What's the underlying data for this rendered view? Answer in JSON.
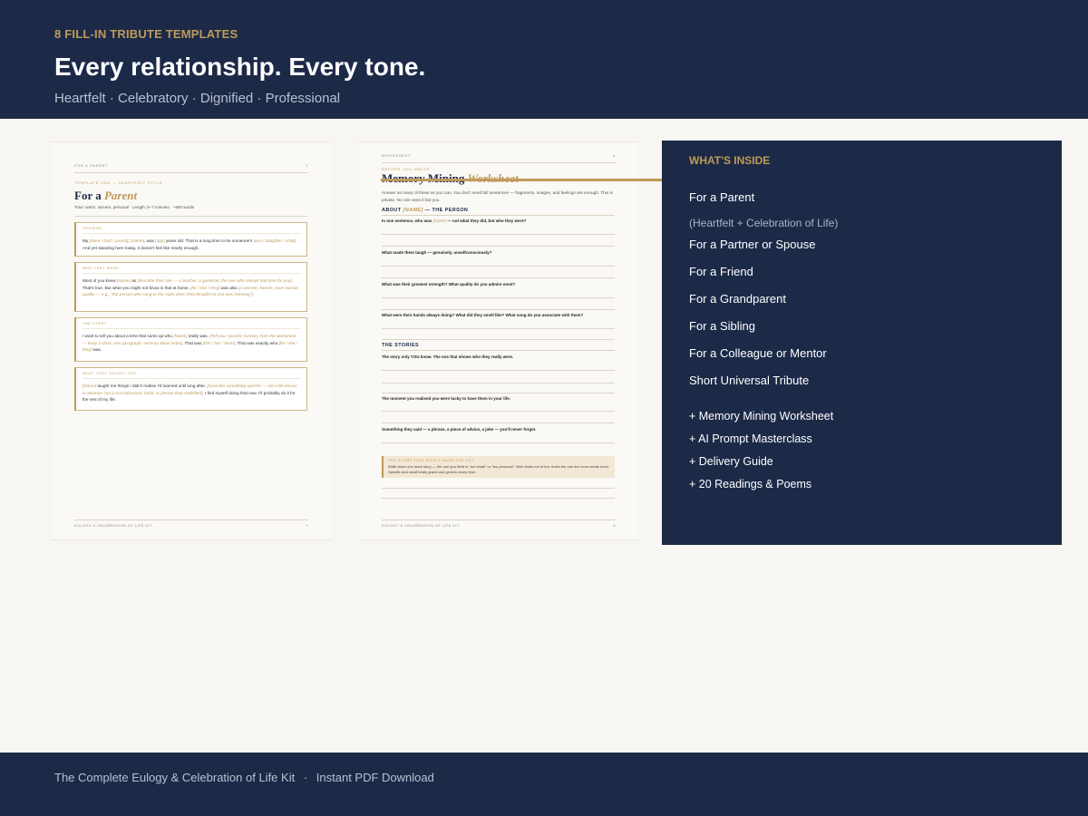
{
  "header": {
    "eyebrow": "8 FILL-IN TRIBUTE TEMPLATES",
    "headline": "Every relationship. Every tone.",
    "subline": "Heartfelt · Celebratory · Dignified · Professional"
  },
  "page1": {
    "running_header": "FOR A PARENT",
    "page_number": "7",
    "kicker": "TEMPLATE ONE — HEARTFELT STYLE",
    "title_prefix": "For a ",
    "title_accent": "Parent",
    "meta": "Tone: warm, sincere, personal · Length: 5–7 minutes · ~900 words",
    "sections": [
      {
        "label": "OPENING",
        "parts": [
          [
            "My ",
            ""
          ],
          [
            "[Mum / Dad / parent]",
            "fill"
          ],
          [
            ", ",
            ""
          ],
          [
            "[Name]",
            "fill"
          ],
          [
            ", was ",
            ""
          ],
          [
            "[age]",
            "fill"
          ],
          [
            " years old. That is a long time to be someone's ",
            ""
          ],
          [
            "[son / daughter / child]",
            "fill"
          ],
          [
            ". And yet standing here today, it doesn't feel like nearly enough.",
            ""
          ]
        ]
      },
      {
        "label": "WHO THEY WERE",
        "parts": [
          [
            "Most of you knew ",
            ""
          ],
          [
            "[Name]",
            "fill"
          ],
          [
            " as ",
            ""
          ],
          [
            "[describe their role — a teacher, a gardener, the one who always had time for you]",
            "fill"
          ],
          [
            ". That's true. But what you might not know is that at home, ",
            ""
          ],
          [
            "[he / she / they]",
            "fill"
          ],
          [
            " was also ",
            ""
          ],
          [
            "[a warmer, funnier, more human quality — e.g., \"the person who sang to the radio when they thought no one was listening\"]",
            "fill"
          ],
          [
            ".",
            ""
          ]
        ]
      },
      {
        "label": "THE STORY",
        "parts": [
          [
            "I want to tell you about a time that sums up who ",
            ""
          ],
          [
            "[Name]",
            "fill"
          ],
          [
            " really was. ",
            ""
          ],
          [
            "[Tell your specific memory from the worksheet — keep it short, one paragraph, sensory detail helps]",
            "fill"
          ],
          [
            ". That was ",
            ""
          ],
          [
            "[him / her / them]",
            "fill"
          ],
          [
            ". That was exactly who ",
            ""
          ],
          [
            "[he / she / they]",
            "fill"
          ],
          [
            " was.",
            ""
          ]
        ]
      },
      {
        "label": "WHAT THEY TAUGHT YOU",
        "parts": [
          [
            "[Name]",
            "fill"
          ],
          [
            " taught me things I didn't realise I'd learned until long after. ",
            ""
          ],
          [
            "[Describe something specific — not a life lesson in abstract, but a real behaviour, habit, or phrase they modelled]",
            "fill"
          ],
          [
            ". I find myself doing that now. I'll probably do it for the rest of my life.",
            ""
          ]
        ]
      }
    ],
    "footer": "EULOGY & CELEBRATION OF LIFE KIT",
    "footer_number": "7"
  },
  "page2": {
    "running_header": "WORKSHEET",
    "page_number": "4",
    "kicker": "BEFORE YOU WRITE",
    "title_prefix": "Memory Mining ",
    "title_accent": "Worksheet",
    "intro": "Answer as many of these as you can. You don't need full sentences — fragments, images, and feelings are enough. This is private. No one sees it but you.",
    "section1_prefix": "ABOUT ",
    "section1_fill": "[NAME]",
    "section1_suffix": " — THE PERSON",
    "q1_prefix": "In one sentence, who was ",
    "q1_fill": "[Name]",
    "q1_suffix": " — not what they did, but who they were?",
    "q2": "What made them laugh — genuinely, unselfconsciously?",
    "q3": "What was their greatest strength? What quality do you admire most?",
    "q4": "What were their hands always doing? What did they smell like? What song do you associate with them?",
    "section2": "THE STORIES",
    "q5": "The story only YOU know. The one that shows who they really were.",
    "q6": "The moment you realised you were lucky to have them in your life.",
    "q7": "Something they said — a phrase, a piece of advice, a joke — you'll never forget.",
    "callout_label": "THE STORY THAT DIDN'T MAKE THE CUT",
    "callout_text": "Write down one more story — the one you think is \"too small\" or \"too personal.\" Nine times out of ten, that's the one the room needs most. Specific and small beats grand and generic every time.",
    "footer": "EULOGY & CELEBRATION OF LIFE KIT",
    "footer_number": "4"
  },
  "inside": {
    "heading": "WHAT'S INSIDE",
    "templates": [
      "For a Parent",
      "(Heartfelt + Celebration of Life)",
      "For a Partner or Spouse",
      "For a Friend",
      "For a Grandparent",
      "For a Sibling",
      "For a Colleague or Mentor",
      "Short Universal Tribute"
    ],
    "extras": [
      "+ Memory Mining Worksheet",
      "+ AI Prompt Masterclass",
      "+ Delivery Guide",
      "+ 20 Readings & Poems"
    ]
  },
  "footer": {
    "product": "The Complete Eulogy & Celebration of Life Kit",
    "separator": "·",
    "delivery": "Instant PDF Download"
  },
  "colors": {
    "navy": "#1c2a48",
    "gold": "#bf9a5a",
    "cream": "#f7f6f2"
  }
}
